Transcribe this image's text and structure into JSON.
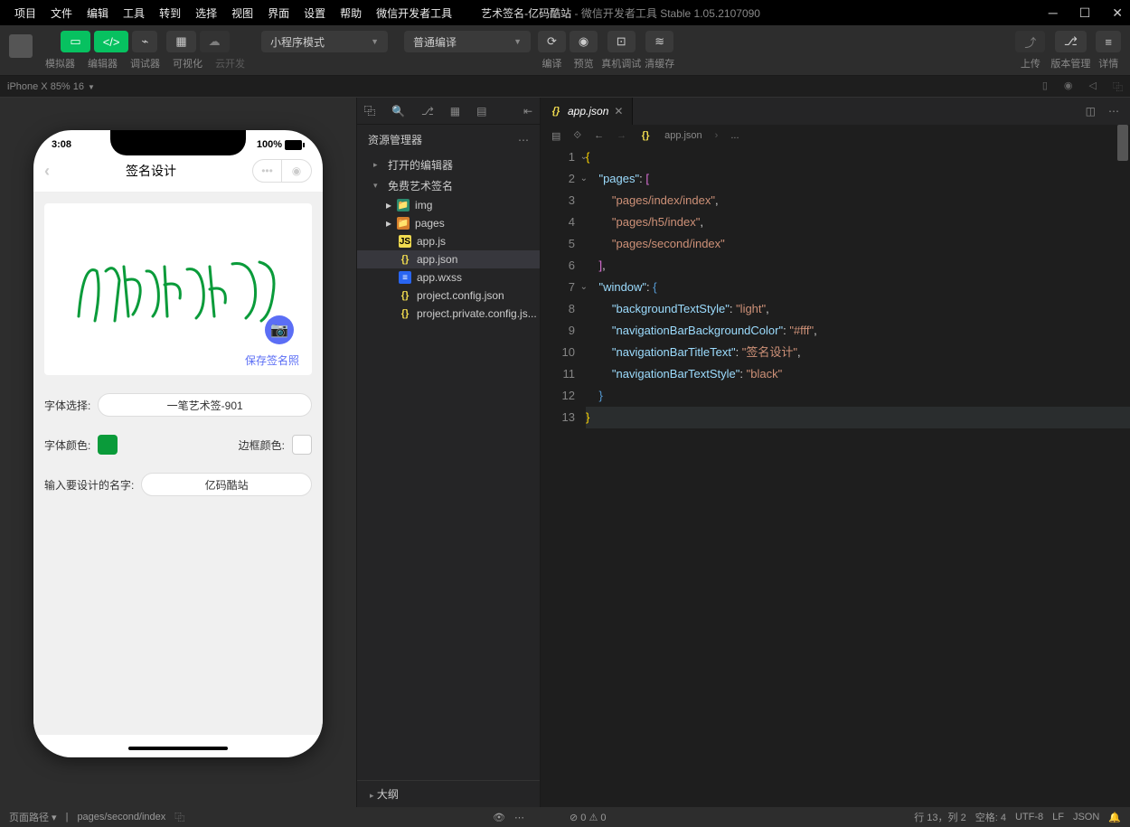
{
  "menu": [
    "项目",
    "文件",
    "编辑",
    "工具",
    "转到",
    "选择",
    "视图",
    "界面",
    "设置",
    "帮助",
    "微信开发者工具"
  ],
  "title": {
    "project": "艺术签名-亿码酷站",
    "app": "微信开发者工具 Stable 1.05.2107090"
  },
  "toolbar": {
    "tabs": [
      "模拟器",
      "编辑器",
      "调试器",
      "可视化",
      "云开发"
    ],
    "mode": "小程序模式",
    "compile": "普通编译",
    "actions": {
      "compile": "编译",
      "preview": "预览",
      "debug": "真机调试",
      "cache": "清缓存"
    },
    "right": {
      "upload": "上传",
      "version": "版本管理",
      "detail": "详情"
    }
  },
  "devbar": {
    "device": "iPhone X 85% 16"
  },
  "simulator": {
    "time": "3:08",
    "battery": "100%",
    "title": "签名设计",
    "save": "保存签名照",
    "form": {
      "fontLabel": "字体选择:",
      "fontValue": "一笔艺术签-901",
      "colorLabel": "字体颜色:",
      "borderLabel": "边框颜色:",
      "nameLabel": "输入要设计的名字:",
      "nameValue": "亿码酷站"
    },
    "colors": {
      "font": "#0a9b3a",
      "border": "#ffffff"
    }
  },
  "explorer": {
    "header": "资源管理器",
    "section1": "打开的编辑器",
    "section2": "免费艺术签名",
    "items": [
      {
        "label": "img",
        "type": "folder-img"
      },
      {
        "label": "pages",
        "type": "folder-pages"
      },
      {
        "label": "app.js",
        "type": "js"
      },
      {
        "label": "app.json",
        "type": "json",
        "active": true
      },
      {
        "label": "app.wxss",
        "type": "wxss"
      },
      {
        "label": "project.config.json",
        "type": "json"
      },
      {
        "label": "project.private.config.js...",
        "type": "json"
      }
    ],
    "outline": "大纲"
  },
  "editor": {
    "tab": "app.json",
    "breadcrumb": [
      "app.json",
      "..."
    ],
    "code": [
      {
        "n": 1,
        "t": "brace",
        "c": "{",
        "fold": true
      },
      {
        "n": 2,
        "t": "kv",
        "i": 1,
        "k": "pages",
        "post": ": ",
        "brack": "[",
        "fold": true
      },
      {
        "n": 3,
        "t": "str",
        "i": 2,
        "v": "pages/index/index",
        "comma": true
      },
      {
        "n": 4,
        "t": "str",
        "i": 2,
        "v": "pages/h5/index",
        "comma": true
      },
      {
        "n": 5,
        "t": "str",
        "i": 2,
        "v": "pages/second/index"
      },
      {
        "n": 6,
        "t": "close",
        "i": 1,
        "brack": "]",
        "comma": true
      },
      {
        "n": 7,
        "t": "kv",
        "i": 1,
        "k": "window",
        "post": ": ",
        "brace2": "{",
        "fold": true
      },
      {
        "n": 8,
        "t": "kv2",
        "i": 2,
        "k": "backgroundTextStyle",
        "v": "light",
        "comma": true
      },
      {
        "n": 9,
        "t": "kv2",
        "i": 2,
        "k": "navigationBarBackgroundColor",
        "v": "#fff",
        "comma": true
      },
      {
        "n": 10,
        "t": "kv2",
        "i": 2,
        "k": "navigationBarTitleText",
        "v": "签名设计",
        "comma": true
      },
      {
        "n": 11,
        "t": "kv2",
        "i": 2,
        "k": "navigationBarTextStyle",
        "v": "black"
      },
      {
        "n": 12,
        "t": "close",
        "i": 1,
        "brace2": "}"
      },
      {
        "n": 13,
        "t": "brace",
        "c": "}",
        "hl": true
      }
    ]
  },
  "status": {
    "path_label": "页面路径",
    "path": "pages/second/index",
    "errors": "0",
    "warnings": "0",
    "pos": "行 13，列 2",
    "spaces": "空格: 4",
    "enc": "UTF-8",
    "eol": "LF",
    "lang": "JSON"
  }
}
